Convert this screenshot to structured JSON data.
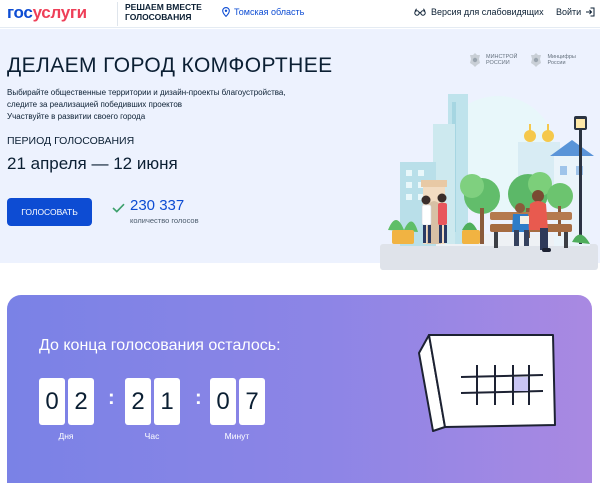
{
  "header": {
    "logo_part1": "гос",
    "logo_part2": "услуги",
    "brand_line1": "Решаем вместе",
    "brand_line2": "Голосования",
    "region": "Томская область",
    "accessibility": "Версия для слабовидящих",
    "login": "Войти"
  },
  "hero": {
    "title": "Делаем город комфортнее",
    "desc_line1": "Выбирайте общественные территории и дизайн-проекты благоустройства,",
    "desc_line2": "следите за реализацией победивших проектов",
    "desc_line3": "Участвуйте в развитии своего города",
    "period_label": "Период голосования",
    "period_value": "21 апреля — 12 июня",
    "vote_button": "Голосовать",
    "votes_count": "230 337",
    "votes_label": "количество голосов",
    "ministry1_line1": "Минстрой",
    "ministry1_line2": "России",
    "ministry2_line1": "Минцифры",
    "ministry2_line2": "России"
  },
  "countdown": {
    "title": "До конца голосования осталось:",
    "days": [
      "0",
      "2"
    ],
    "hours": [
      "2",
      "1"
    ],
    "minutes": [
      "0",
      "7"
    ],
    "days_label": "Дня",
    "hours_label": "Час",
    "minutes_label": "Минут"
  },
  "colors": {
    "brand_blue": "#0d4cd3",
    "brand_red": "#ee3f58",
    "hero_bg": "#edf2fe",
    "countdown_bg": "#8d85e6"
  },
  "icons": [
    "location-pin-icon",
    "glasses-icon",
    "login-arrow-icon",
    "check-icon",
    "ministry-emblem-icon",
    "calendar-icon"
  ]
}
